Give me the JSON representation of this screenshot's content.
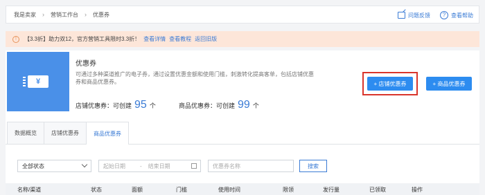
{
  "breadcrumb": [
    "我是卖家",
    "营销工作台",
    "优惠券"
  ],
  "header_tools": {
    "feedback": "问题反馈",
    "help": "查看帮助",
    "help_icon": "?"
  },
  "notice": {
    "text": "【3.3折】助力双12，官方营销工具限时3.3折！",
    "links": [
      "查看详情",
      "查看教程",
      "返回旧版"
    ],
    "icon": "!"
  },
  "coupon": {
    "title": "优惠券",
    "description": "可通过多种渠道推广的电子券，通过设置优惠金额和使用门槛，刺激转化提高客单，包括店铺优惠券和商品优惠券。",
    "art_symbol": "¥",
    "shop_quota": {
      "label": "店铺优惠券：可创建",
      "count": "95",
      "unit": "个"
    },
    "item_quota": {
      "label": "商品优惠券：可创建",
      "count": "99",
      "unit": "个"
    },
    "create_shop_button": "+ 店铺优惠券",
    "create_item_button": "+ 商品优惠券"
  },
  "tabs": [
    {
      "label": "数据概览"
    },
    {
      "label": "店铺优惠券"
    },
    {
      "label": "商品优惠券",
      "active": true
    }
  ],
  "filters": {
    "status": "全部状态",
    "date_start_placeholder": "起始日期",
    "date_separator": "-",
    "date_end_placeholder": "结束日期",
    "name_placeholder": "优惠券名称",
    "search_button": "搜索"
  },
  "table": {
    "columns": [
      "名称/渠道",
      "状态",
      "面额",
      "门槛",
      "使用时间",
      "限领",
      "发行量",
      "已领取",
      "操作"
    ]
  },
  "colors": {
    "accent": "#2d8cf0",
    "highlight": "#d9342b",
    "notice_bg": "#fde6d9",
    "art_bg": "#4a90e8"
  }
}
